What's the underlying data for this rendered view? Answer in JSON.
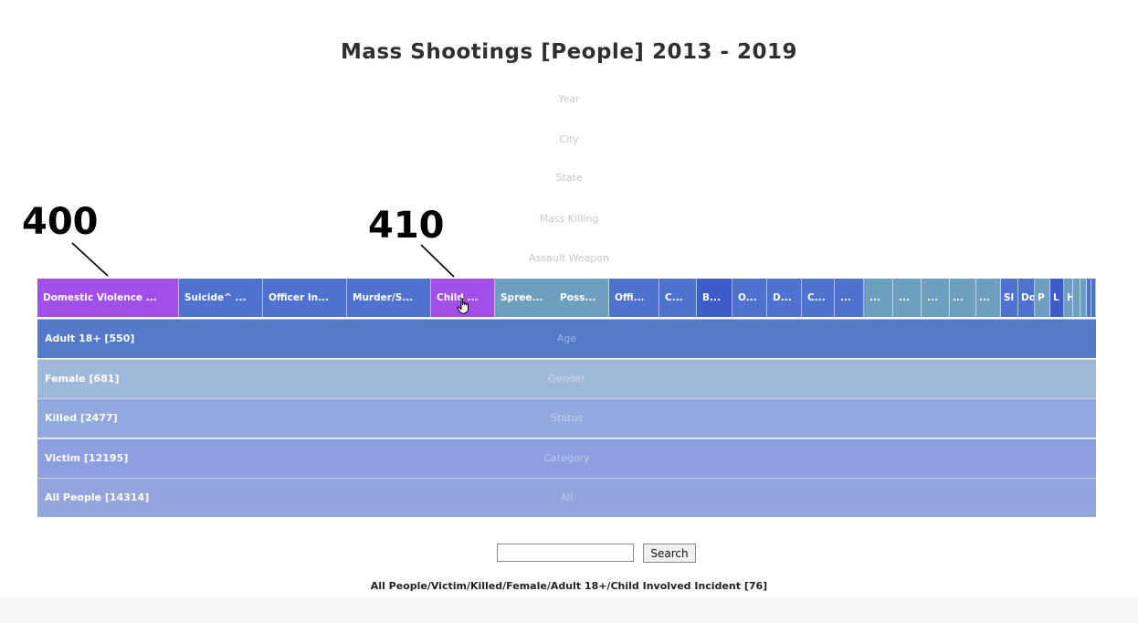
{
  "title": "Mass Shootings [People] 2013 - 2019",
  "dimension_labels": {
    "year": "Year",
    "city": "City",
    "state": "State",
    "mass_killing": "Mass Killing",
    "assault_weapon": "Assault Weapon"
  },
  "reference_numerals": {
    "r400": "400",
    "r410": "410"
  },
  "incident_bar": {
    "segments": [
      {
        "label": "Domestic Violence ...",
        "color": "#a24fe8"
      },
      {
        "label": "Suicide^ ...",
        "color": "#4f72cf"
      },
      {
        "label": "Officer In...",
        "color": "#4f72cf"
      },
      {
        "label": "Murder/S...",
        "color": "#4f72cf"
      },
      {
        "label": "Child ...",
        "color": "#a24fe8"
      },
      {
        "label": "Spree...",
        "color": "#6f9fbe"
      },
      {
        "label": "Poss...",
        "color": "#6f9fbe"
      },
      {
        "label": "Offi...",
        "color": "#4f72cf"
      },
      {
        "label": "C...",
        "color": "#4f72cf"
      },
      {
        "label": "B...",
        "color": "#3d5bc9"
      },
      {
        "label": "O...",
        "color": "#4f72cf"
      },
      {
        "label": "D...",
        "color": "#4f72cf"
      },
      {
        "label": "C...",
        "color": "#4f72cf"
      },
      {
        "label": "...",
        "color": "#4f72cf"
      },
      {
        "label": "...",
        "color": "#6f9fbe"
      },
      {
        "label": "...",
        "color": "#6f9fbe"
      },
      {
        "label": "...",
        "color": "#6f9fbe"
      },
      {
        "label": "...",
        "color": "#6f9fbe"
      },
      {
        "label": "...",
        "color": "#6f9fbe"
      },
      {
        "label": "Sl",
        "color": "#4f72cf"
      },
      {
        "label": "Do",
        "color": "#4f72cf"
      },
      {
        "label": "P",
        "color": "#6f9fbe"
      },
      {
        "label": "L",
        "color": "#3d5bc9"
      },
      {
        "label": "H",
        "color": "#6f9fbe"
      },
      {
        "label": "",
        "color": "#6f9fbe"
      },
      {
        "label": "",
        "color": "#6f9fbe"
      },
      {
        "label": "",
        "color": "#4f72cf"
      },
      {
        "label": "",
        "color": "#4f72cf"
      }
    ]
  },
  "rows": [
    {
      "label": "Adult 18+ [550]",
      "dimension": "Age",
      "color": "#5479c8"
    },
    {
      "label": "Female [681]",
      "dimension": "Gender",
      "color": "#a0b9db"
    },
    {
      "label": "Killed [2477]",
      "dimension": "Status",
      "color": "#92a8de"
    },
    {
      "label": "Victim [12195]",
      "dimension": "Category",
      "color": "#8d9fe0"
    },
    {
      "label": "All People [14314]",
      "dimension": "All",
      "color": "#94a5dd"
    }
  ],
  "search": {
    "value": "",
    "button_label": "Search"
  },
  "path_text": "All People/Victim/Killed/Female/Adult 18+/Child Involved Incident [76]",
  "icons": {
    "cursor": "hand-pointer-icon"
  }
}
